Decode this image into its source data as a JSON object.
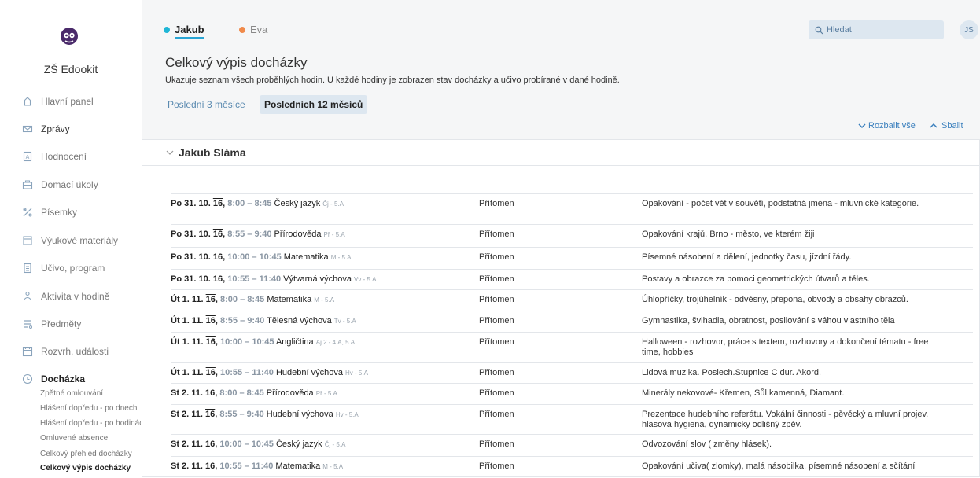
{
  "sidebar": {
    "school_name": "ZŠ Edookit",
    "items": [
      {
        "label": "Hlavní panel",
        "icon": "home-icon"
      },
      {
        "label": "Zprávy",
        "icon": "mail-icon"
      },
      {
        "label": "Hodnocení",
        "icon": "grade-icon"
      },
      {
        "label": "Domácí úkoly",
        "icon": "homework-icon"
      },
      {
        "label": "Písemky",
        "icon": "test-icon"
      },
      {
        "label": "Výukové materiály",
        "icon": "materials-icon"
      },
      {
        "label": "Učivo, program",
        "icon": "curriculum-icon"
      },
      {
        "label": "Aktivita v hodině",
        "icon": "activity-icon"
      },
      {
        "label": "Předměty",
        "icon": "subjects-icon"
      },
      {
        "label": "Rozvrh, události",
        "icon": "calendar-icon"
      },
      {
        "label": "Docházka",
        "icon": "clock-icon"
      }
    ],
    "sub_items": [
      "Zpětné omlouvání",
      "Hlášení dopředu - po dnech",
      "Hlášení dopředu - po hodinách",
      "Omluvené absence",
      "Celkový přehled docházky",
      "Celkový výpis docházky"
    ]
  },
  "header": {
    "children": [
      {
        "label": "Jakub",
        "color": "#1fb6d6"
      },
      {
        "label": "Eva",
        "color": "#f08a4b"
      }
    ],
    "search_placeholder": "Hledat",
    "avatar_initials": "JS"
  },
  "page": {
    "title": "Celkový výpis docházky",
    "description": "Ukazuje seznam všech proběhlých hodin. U každé hodiny je zobrazen stav docházky a učivo probírané v dané hodině.",
    "period_options": [
      "Poslední 3 měsíce",
      "Posledních 12 měsíců"
    ],
    "expand_all": "Rozbalit vše",
    "collapse_all": "Sbalit"
  },
  "student": {
    "name": "Jakub Sláma",
    "lessons": [
      {
        "day": "Po 31. 10.",
        "year": "16",
        "time": "8:00 – 8:45",
        "subject": "Český jazyk",
        "meta": "Čj - 5.A",
        "attendance": "Přítomen",
        "topic": "Opakování - počet vět v souvětí, podstatná jména - mluvnické kategorie."
      },
      {
        "day": "Po 31. 10.",
        "year": "16",
        "time": "8:55 – 9:40",
        "subject": "Přírodověda",
        "meta": "Př - 5.A",
        "attendance": "Přítomen",
        "topic": "Opakování krajů, Brno - město, ve kterém žiji"
      },
      {
        "day": "Po 31. 10.",
        "year": "16",
        "time": "10:00 – 10:45",
        "subject": "Matematika",
        "meta": "M - 5.A",
        "attendance": "Přítomen",
        "topic": "Písemné násobení a dělení, jednotky času, jízdní řády."
      },
      {
        "day": "Po 31. 10.",
        "year": "16",
        "time": "10:55 – 11:40",
        "subject": "Výtvarná výchova",
        "meta": "Vv - 5.A",
        "attendance": "Přítomen",
        "topic": "Postavy a obrazce za pomoci geometrických útvarů a těles."
      },
      {
        "day": "Út 1. 11.",
        "year": "16",
        "time": "8:00 – 8:45",
        "subject": "Matematika",
        "meta": "M - 5.A",
        "attendance": "Přítomen",
        "topic": "Úhlopříčky, trojúhelník - odvěsny, přepona, obvody a obsahy obrazců."
      },
      {
        "day": "Út 1. 11.",
        "year": "16",
        "time": "8:55 – 9:40",
        "subject": "Tělesná výchova",
        "meta": "Tv - 5.A",
        "attendance": "Přítomen",
        "topic": "Gymnastika, švihadla, obratnost, posilování s váhou vlastního těla"
      },
      {
        "day": "Út 1. 11.",
        "year": "16",
        "time": "10:00 – 10:45",
        "subject": "Angličtina",
        "meta": "Aj 2 - 4.A, 5.A",
        "attendance": "Přítomen",
        "topic": "Halloween - rozhovor, práce s textem, rozhovory a dokončení tématu - free time, hobbies"
      },
      {
        "day": "Út 1. 11.",
        "year": "16",
        "time": "10:55 – 11:40",
        "subject": "Hudební výchova",
        "meta": "Hv - 5.A",
        "attendance": "Přítomen",
        "topic": "Lidová muzika. Poslech.Stupnice C dur. Akord."
      },
      {
        "day": "St 2. 11.",
        "year": "16",
        "time": "8:00 – 8:45",
        "subject": "Přírodověda",
        "meta": "Př - 5.A",
        "attendance": "Přítomen",
        "topic": "Minerály nekovové- Křemen, Sůl kamenná, Diamant."
      },
      {
        "day": "St 2. 11.",
        "year": "16",
        "time": "8:55 – 9:40",
        "subject": "Hudební výchova",
        "meta": "Hv - 5.A",
        "attendance": "Přítomen",
        "topic": "Prezentace hudebního referátu. Vokální činnosti - pěvěcký a mluvní projev, hlasová hygiena, dynamicky odlišný zpěv."
      },
      {
        "day": "St 2. 11.",
        "year": "16",
        "time": "10:00 – 10:45",
        "subject": "Český jazyk",
        "meta": "Čj - 5.A",
        "attendance": "Přítomen",
        "topic": "Odvozování slov ( změny hlásek)."
      },
      {
        "day": "St 2. 11.",
        "year": "16",
        "time": "10:55 – 11:40",
        "subject": "Matematika",
        "meta": "M - 5.A",
        "attendance": "Přítomen",
        "topic": "Opakování učiva( zlomky), malá násobilka, písemné násobení a sčítání"
      }
    ]
  }
}
